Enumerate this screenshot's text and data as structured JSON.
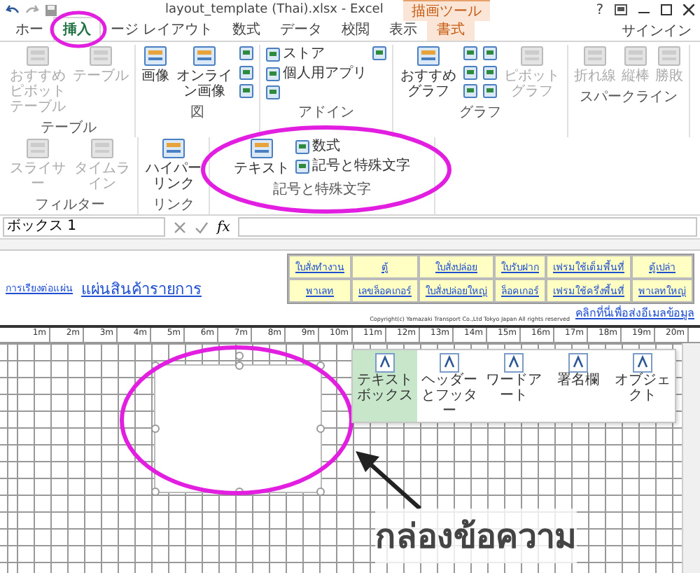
{
  "window": {
    "title": "layout_template (Thai).xlsx - Excel",
    "context_label": "描画ツール",
    "help": "?",
    "account": "サインイン"
  },
  "tabs": [
    {
      "label": "ホー",
      "kind": "normal",
      "selected": false
    },
    {
      "label": "挿入",
      "kind": "normal",
      "selected": true
    },
    {
      "label": "ージ レイアウト",
      "kind": "normal",
      "selected": false
    },
    {
      "label": "数式",
      "kind": "normal",
      "selected": false
    },
    {
      "label": "データ",
      "kind": "normal",
      "selected": false
    },
    {
      "label": "校閲",
      "kind": "normal",
      "selected": false
    },
    {
      "label": "表示",
      "kind": "normal",
      "selected": false
    },
    {
      "label": "書式",
      "kind": "context",
      "selected": false
    }
  ],
  "ribbon": {
    "groups": [
      {
        "label": "テーブル",
        "buttons": [
          {
            "kind": "large",
            "label": "おすすめピボットテーブル",
            "disabled": true
          },
          {
            "kind": "large",
            "label": "テーブル",
            "disabled": true
          }
        ]
      },
      {
        "label": "図",
        "buttons": [
          {
            "kind": "large",
            "label": "画像",
            "disabled": false
          },
          {
            "kind": "large",
            "label": "オンライン画像",
            "disabled": false
          },
          {
            "kind": "icon",
            "disabled": false
          },
          {
            "kind": "icon",
            "disabled": false
          },
          {
            "kind": "icon",
            "disabled": false
          }
        ]
      },
      {
        "label": "アドイン",
        "buttons": [
          {
            "kind": "small",
            "label": "ストア",
            "disabled": false
          },
          {
            "kind": "small",
            "label": "個人用アプリ",
            "disabled": false
          },
          {
            "kind": "icon",
            "disabled": false
          },
          {
            "kind": "icon",
            "disabled": false
          }
        ]
      },
      {
        "label": "グラフ",
        "buttons": [
          {
            "kind": "large",
            "label": "おすすめグラフ",
            "disabled": false
          },
          {
            "kind": "icon",
            "disabled": false
          },
          {
            "kind": "icon",
            "disabled": false
          },
          {
            "kind": "icon",
            "disabled": false
          },
          {
            "kind": "icon",
            "disabled": false
          },
          {
            "kind": "icon",
            "disabled": false
          },
          {
            "kind": "icon",
            "disabled": false
          },
          {
            "kind": "large",
            "label": "ピボットグラフ",
            "disabled": true
          }
        ]
      },
      {
        "label": "スパークライン",
        "buttons": [
          {
            "kind": "large",
            "label": "折れ線",
            "disabled": true
          },
          {
            "kind": "large",
            "label": "縦棒",
            "disabled": true
          },
          {
            "kind": "large",
            "label": "勝敗",
            "disabled": true
          }
        ]
      },
      {
        "label": "フィルター",
        "buttons": [
          {
            "kind": "large",
            "label": "スライサー",
            "disabled": true
          },
          {
            "kind": "large",
            "label": "タイムライン",
            "disabled": true
          }
        ]
      },
      {
        "label": "リンク",
        "buttons": [
          {
            "kind": "large",
            "label": "ハイパーリンク",
            "disabled": false
          }
        ]
      },
      {
        "label": "記号と特殊文字",
        "buttons": [
          {
            "kind": "large",
            "label": "テキスト",
            "disabled": false
          },
          {
            "kind": "small",
            "label": "数式",
            "disabled": false
          },
          {
            "kind": "small",
            "label": "記号と特殊文字",
            "disabled": false
          }
        ]
      }
    ]
  },
  "text_menu": {
    "items": [
      {
        "label": "テキストボックス",
        "selected": true
      },
      {
        "label": "ヘッダーとフッター",
        "selected": false
      },
      {
        "label": "ワードアート",
        "selected": false
      },
      {
        "label": "署名欄",
        "selected": false
      },
      {
        "label": "オブジェクト",
        "selected": false
      }
    ]
  },
  "formula_bar": {
    "name_box": "ボックス 1",
    "fx": "fx"
  },
  "sheet": {
    "side_link": "การเรียงต่อแผ่น",
    "title": "แผ่นสินค้ารายการ",
    "info_table": [
      [
        "ใบสั่งทำงาน",
        "ตู้",
        "ใบสั่งปล่อย",
        "ใบรับฝาก",
        "เฟรมใช้เต็มพื้นที่",
        "ตู้เปล่า"
      ],
      [
        "พาเลท",
        "เลขล็อคเกอร์",
        "ใบสั่งปล่อยใหญ่",
        "ล็อคเกอร์",
        "เฟรมใช้ครึ่งพื้นที่",
        "พาเลทใหญ่"
      ]
    ],
    "copyright": "Copyright(c) Yamazaki Transport Co.,Ltd Tokyo Japan All rights reserved",
    "email_link": "คลิกที่นี่เพื่อส่งอีเมลข้อมูล",
    "ruler": [
      "1m",
      "2m",
      "3m",
      "4m",
      "5m",
      "6m",
      "7m",
      "8m",
      "9m",
      "10m",
      "11m",
      "12m",
      "13m",
      "14m",
      "15m",
      "16m",
      "17m",
      "18m",
      "19m",
      "20m"
    ]
  },
  "annotation": {
    "caption": "กล่องข้อความ"
  }
}
